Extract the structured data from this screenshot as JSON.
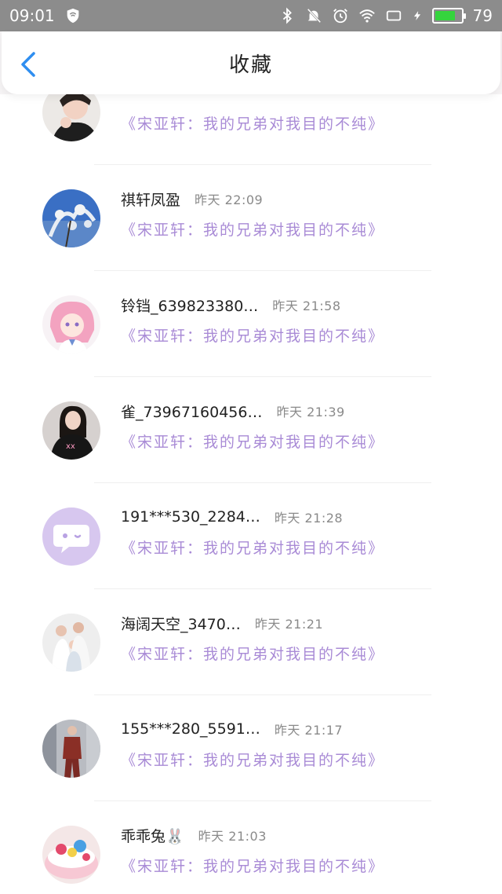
{
  "status_bar": {
    "time": "09:01",
    "battery": "79",
    "battery_level": 0.79
  },
  "header": {
    "title": "收藏"
  },
  "rows": [
    {
      "name": "",
      "time_label": "",
      "time": "",
      "message": "《宋亚轩：我的兄弟对我目的不纯》"
    },
    {
      "name": "祺轩凤盈",
      "time_label": "昨天",
      "time": "22:09",
      "message": "《宋亚轩：我的兄弟对我目的不纯》"
    },
    {
      "name": "铃铛_639823380…",
      "time_label": "昨天",
      "time": "21:58",
      "message": "《宋亚轩：我的兄弟对我目的不纯》"
    },
    {
      "name": "雀_73967160456…",
      "time_label": "昨天",
      "time": "21:39",
      "message": "《宋亚轩：我的兄弟对我目的不纯》"
    },
    {
      "name": "191***530_2284…",
      "time_label": "昨天",
      "time": "21:28",
      "message": "《宋亚轩：我的兄弟对我目的不纯》"
    },
    {
      "name": "海阔天空_3470…",
      "time_label": "昨天",
      "time": "21:21",
      "message": "《宋亚轩：我的兄弟对我目的不纯》"
    },
    {
      "name": "155***280_5591…",
      "time_label": "昨天",
      "time": "21:17",
      "message": "《宋亚轩：我的兄弟对我目的不纯》"
    },
    {
      "name": "乖乖兔🐰",
      "time_label": "昨天",
      "time": "21:03",
      "message": "《宋亚轩：我的兄弟对我目的不纯》"
    }
  ],
  "colors": {
    "accent": "#2f8ef0",
    "message": "#a98bd6",
    "status_bar": "#8c8c8c"
  }
}
